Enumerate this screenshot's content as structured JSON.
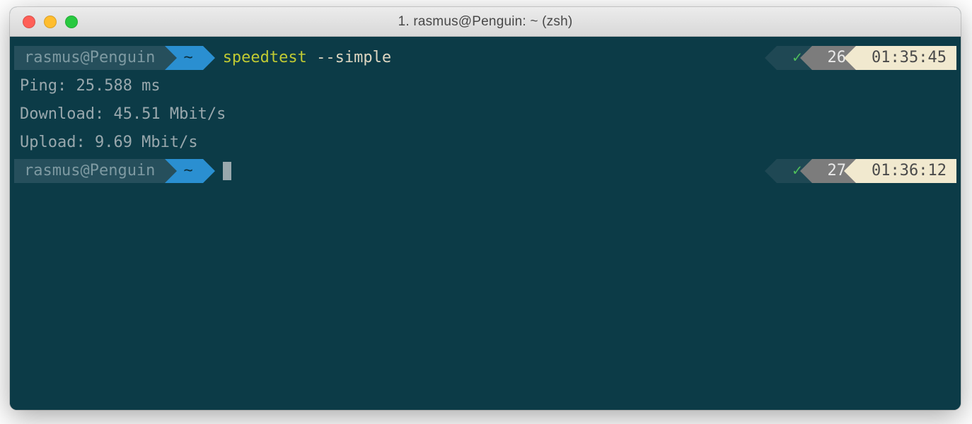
{
  "window": {
    "title": "1. rasmus@Penguin: ~ (zsh)"
  },
  "colors": {
    "terminal_bg": "#0C3B47",
    "host_bg": "#264F5C",
    "dir_bg": "#2A8FD1",
    "exec": "#C0CA33",
    "right_num_bg": "#7C7C7C",
    "right_time_bg": "#F1E9CF",
    "check_color": "#4FBF5B"
  },
  "lines": [
    {
      "type": "prompt",
      "host": "rasmus@Penguin",
      "dir": "~",
      "command_exe": "speedtest",
      "command_args": " --simple",
      "status_ok": "✓",
      "status_num": "26",
      "status_time": "01:35:45"
    },
    {
      "type": "output",
      "text": "Ping: 25.588 ms"
    },
    {
      "type": "output",
      "text": "Download: 45.51 Mbit/s"
    },
    {
      "type": "output",
      "text": "Upload: 9.69 Mbit/s"
    },
    {
      "type": "prompt",
      "host": "rasmus@Penguin",
      "dir": "~",
      "command_exe": "",
      "command_args": "",
      "cursor": true,
      "status_ok": "✓",
      "status_num": "27",
      "status_time": "01:36:12"
    }
  ]
}
